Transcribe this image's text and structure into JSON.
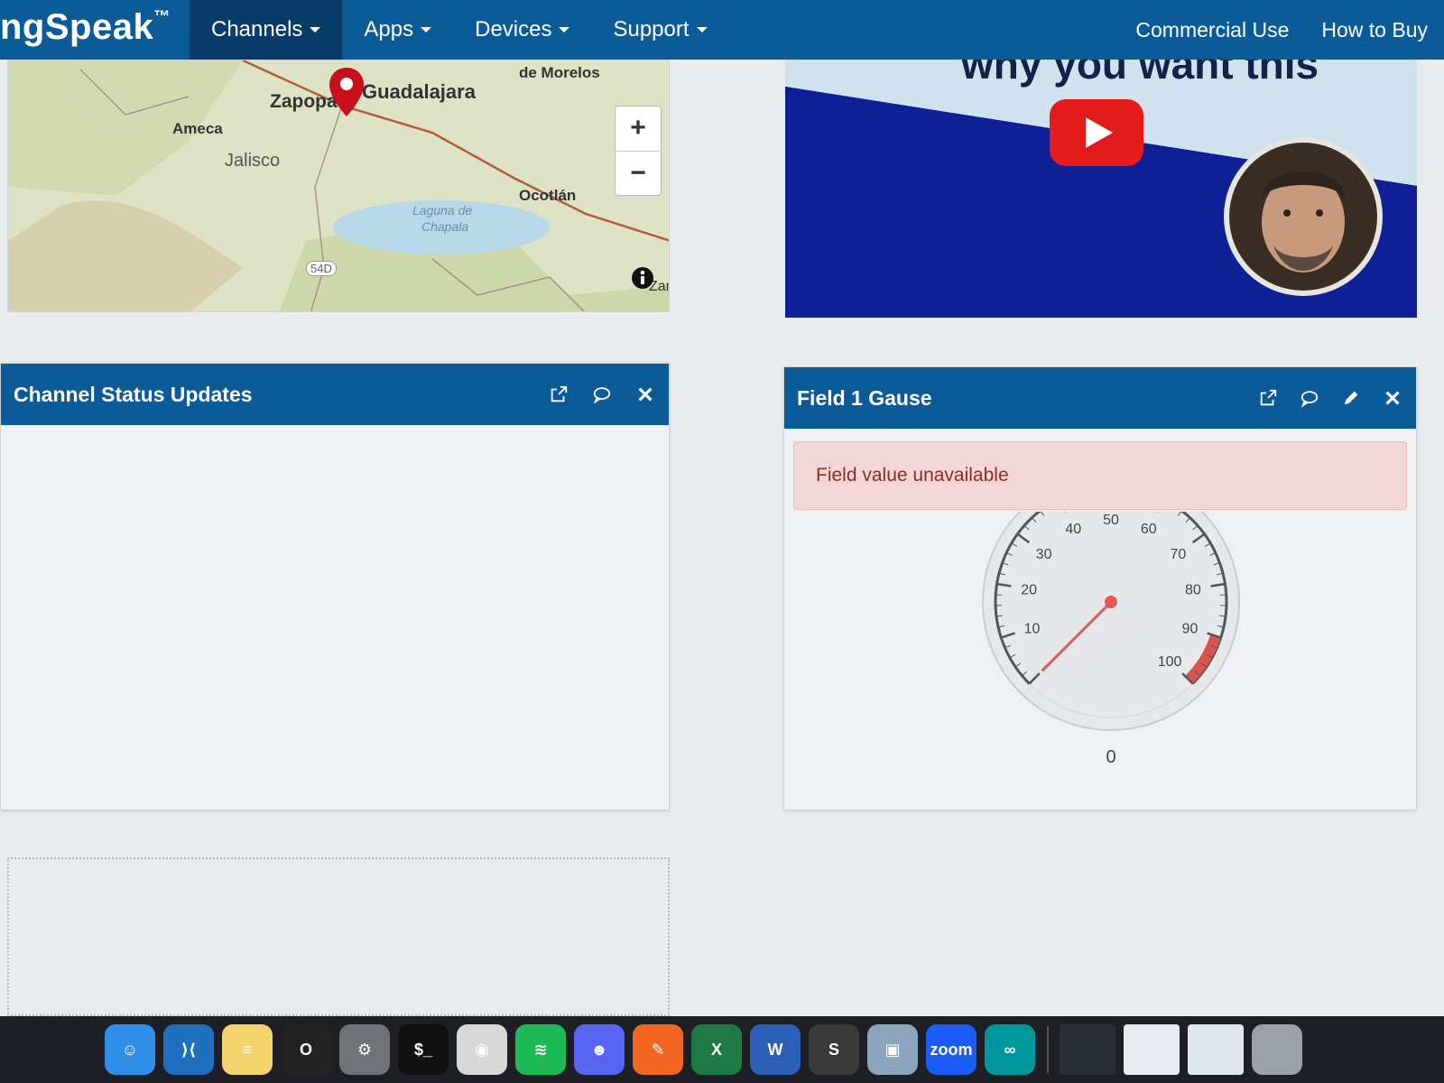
{
  "navbar": {
    "brand": "ngSpeak",
    "brand_mark": "™",
    "items": [
      {
        "label": "Channels",
        "active": true
      },
      {
        "label": "Apps",
        "active": false
      },
      {
        "label": "Devices",
        "active": false
      },
      {
        "label": "Support",
        "active": false
      }
    ],
    "right_links": [
      "Commercial Use",
      "How to Buy"
    ]
  },
  "map_widget": {
    "labels": {
      "city_main": "Guadalajara",
      "city_zapopan": "Zapopa",
      "ameca": "Ameca",
      "jalisco": "Jalisco",
      "de_morelos": "de Morelos",
      "ocotlan": "Ocotlán",
      "laguna_1": "Laguna de",
      "laguna_2": "Chapala",
      "road": "54D",
      "edge": "Zar"
    },
    "zoom_in": "+",
    "zoom_out": "−"
  },
  "video_widget": {
    "title_text": "why you want this"
  },
  "status_widget": {
    "title": "Channel Status Updates",
    "tools": [
      "external-link-icon",
      "comment-icon",
      "close-icon"
    ]
  },
  "gauge_widget": {
    "title": "Field 1 Gause",
    "tools": [
      "external-link-icon",
      "comment-icon",
      "pencil-icon",
      "close-icon"
    ],
    "alert": "Field value unavailable",
    "gauge": {
      "min": 0,
      "max": 100,
      "value": 0,
      "value_label": "0",
      "tick_labels": [
        "10",
        "20",
        "30",
        "40",
        "50",
        "60",
        "70",
        "80",
        "90",
        "100"
      ],
      "needle_color": "#e05a5a",
      "danger_band": [
        90,
        100
      ],
      "danger_color": "#d9534f"
    }
  },
  "dock": {
    "apps": [
      {
        "name": "finder-icon",
        "color": "#2f8fe8",
        "glyph": "☺"
      },
      {
        "name": "vscode-icon",
        "color": "#1f6fbf",
        "glyph": "⟩⟨"
      },
      {
        "name": "notes-icon",
        "color": "#f3d36b",
        "glyph": "≡"
      },
      {
        "name": "opera-icon",
        "color": "#222",
        "glyph": "O"
      },
      {
        "name": "system-settings-icon",
        "color": "#6f7378",
        "glyph": "⚙"
      },
      {
        "name": "terminal-icon",
        "color": "#111",
        "glyph": "$_"
      },
      {
        "name": "screenshot-icon",
        "color": "#d8d8d8",
        "glyph": "◉"
      },
      {
        "name": "spotify-icon",
        "color": "#1db954",
        "glyph": "≋"
      },
      {
        "name": "discord-icon",
        "color": "#5865f2",
        "glyph": "☻"
      },
      {
        "name": "pencil-app-icon",
        "color": "#f26522",
        "glyph": "✎"
      },
      {
        "name": "excel-icon",
        "color": "#1d7a45",
        "glyph": "X"
      },
      {
        "name": "word-icon",
        "color": "#2b5fb8",
        "glyph": "W"
      },
      {
        "name": "sublime-icon",
        "color": "#3a3a3a",
        "glyph": "S"
      },
      {
        "name": "preview-icon",
        "color": "#8ca5bf",
        "glyph": "▣"
      },
      {
        "name": "zoom-icon",
        "color": "#1a5cf5",
        "glyph": "zoom"
      },
      {
        "name": "arduino-icon",
        "color": "#00979c",
        "glyph": "∞"
      }
    ],
    "recent": [
      {
        "name": "recent-window-1-icon",
        "color": "#2a2e36"
      },
      {
        "name": "recent-window-2-icon",
        "color": "#e7eaee"
      },
      {
        "name": "recent-window-3-icon",
        "color": "#dfe6ee"
      }
    ],
    "trash": {
      "name": "trash-icon",
      "color": "#9aa0a6"
    }
  }
}
